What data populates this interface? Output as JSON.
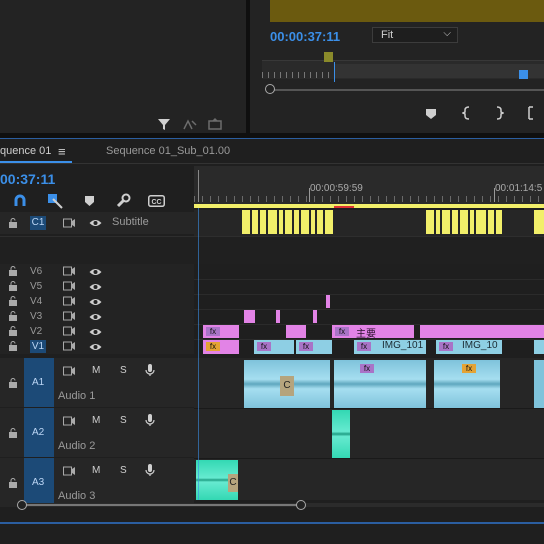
{
  "program_monitor": {
    "timecode": "00:00:37:11",
    "zoom_select": "Fit"
  },
  "timeline": {
    "tabs": [
      {
        "label": "quence 01",
        "active": true
      },
      {
        "label": "Sequence 01_Sub_01.00",
        "active": false
      }
    ],
    "menu_icon": "≡",
    "timecode": "00:37:11",
    "ruler_labels": [
      "00:00:59:59",
      "00:01:14:5"
    ],
    "caption_track": {
      "name": "C1",
      "label": "Subtitle"
    },
    "video_tracks": [
      "V6",
      "V5",
      "V4",
      "V3",
      "V2",
      "V1"
    ],
    "audio_tracks": [
      {
        "id": "A1",
        "name": "Audio 1"
      },
      {
        "id": "A2",
        "name": "Audio 2"
      },
      {
        "id": "A3",
        "name": "Audio 3"
      }
    ],
    "track_buttons": {
      "mute": "M",
      "solo": "S"
    },
    "clips": {
      "v2_title": "主要",
      "v1_clip_a": "IMG_101",
      "v1_clip_b": "IMG_10",
      "fx": "fx",
      "transition": "C"
    }
  },
  "colors": {
    "accent": "#3b8fe8",
    "caption": "#f2ef6a",
    "video_clip": "#8ecfe4",
    "graphic_clip": "#e283e6",
    "audio_clip": "#7fc3db",
    "audio_clip_alt": "#33d8b3"
  },
  "icons": [
    "filter-icon",
    "export-frame-icon",
    "lift-icon",
    "marker-icon",
    "mark-in-icon",
    "mark-out-icon",
    "snap-icon",
    "linked-selection-icon",
    "add-marker-icon",
    "wrench-icon",
    "captions-icon",
    "lock-icon",
    "toggle-output-icon",
    "eye-icon",
    "microphone-icon"
  ]
}
